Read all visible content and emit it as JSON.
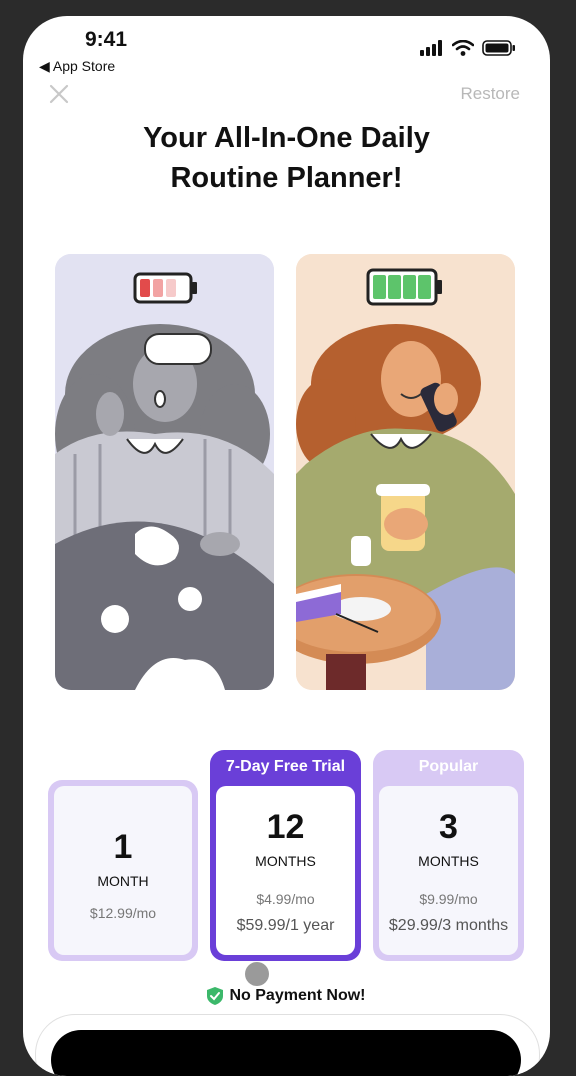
{
  "status_bar": {
    "time": "9:41",
    "back_label": "◀ App Store"
  },
  "header": {
    "restore_label": "Restore"
  },
  "title": {
    "line1": "Your All-In-One Daily",
    "line2": "Routine Planner!"
  },
  "illustrations": {
    "left_icon": "battery-low-icon",
    "right_icon": "battery-full-icon"
  },
  "plans": [
    {
      "badge": "",
      "number": "1",
      "unit": "MONTH",
      "price_per_month": "$12.99/mo",
      "total": ""
    },
    {
      "badge": "7-Day Free Trial",
      "number": "12",
      "unit": "MONTHS",
      "price_per_month": "$4.99/mo",
      "total": "$59.99/1 year"
    },
    {
      "badge": "Popular",
      "number": "3",
      "unit": "MONTHS",
      "price_per_month": "$9.99/mo",
      "total": "$29.99/3 months"
    }
  ],
  "footer": {
    "no_payment": "No Payment Now!"
  },
  "colors": {
    "accent": "#6a3fd8",
    "accent_light": "#d8c9f4",
    "check": "#3bb86a"
  }
}
